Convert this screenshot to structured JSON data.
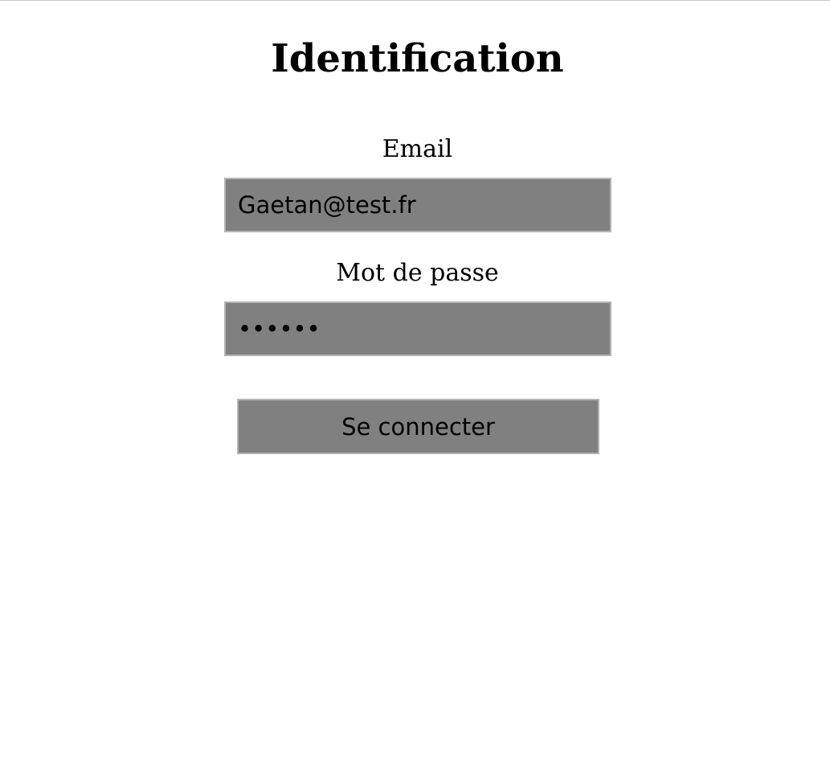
{
  "page": {
    "title": "Identification"
  },
  "form": {
    "email_label": "Email",
    "email_value": "Gaetan@test.fr",
    "password_label": "Mot de passe",
    "password_value": "••••••",
    "submit_label": "Se connecter"
  },
  "colors": {
    "background": "#ffffff",
    "field_fill": "#808080",
    "field_border": "#b4b4b4",
    "text": "#000000"
  }
}
